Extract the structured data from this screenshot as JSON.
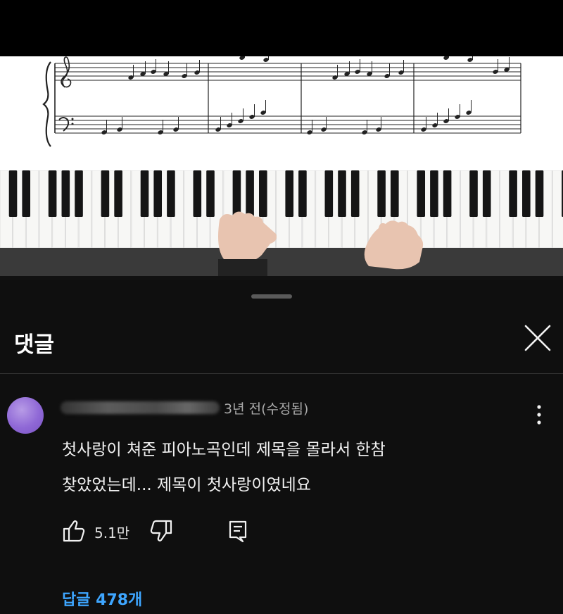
{
  "video": {
    "content": "piano tutorial with sheet music"
  },
  "comments_panel": {
    "title": "댓글",
    "close_icon": "close-icon",
    "comment": {
      "meta": "3년 전(수정됨)",
      "text_line1": "첫사랑이 쳐준 피아노곡인데 제목을 몰라서 한참",
      "text_line2": "찾았었는데... 제목이 첫사랑이였네요",
      "like_count": "5.1만",
      "replies_label": "답글 478개"
    },
    "colors": {
      "background": "#0f0f0f",
      "link": "#3ea6ff",
      "meta_text": "#aaaaaa",
      "avatar": "#8f68d6"
    }
  }
}
